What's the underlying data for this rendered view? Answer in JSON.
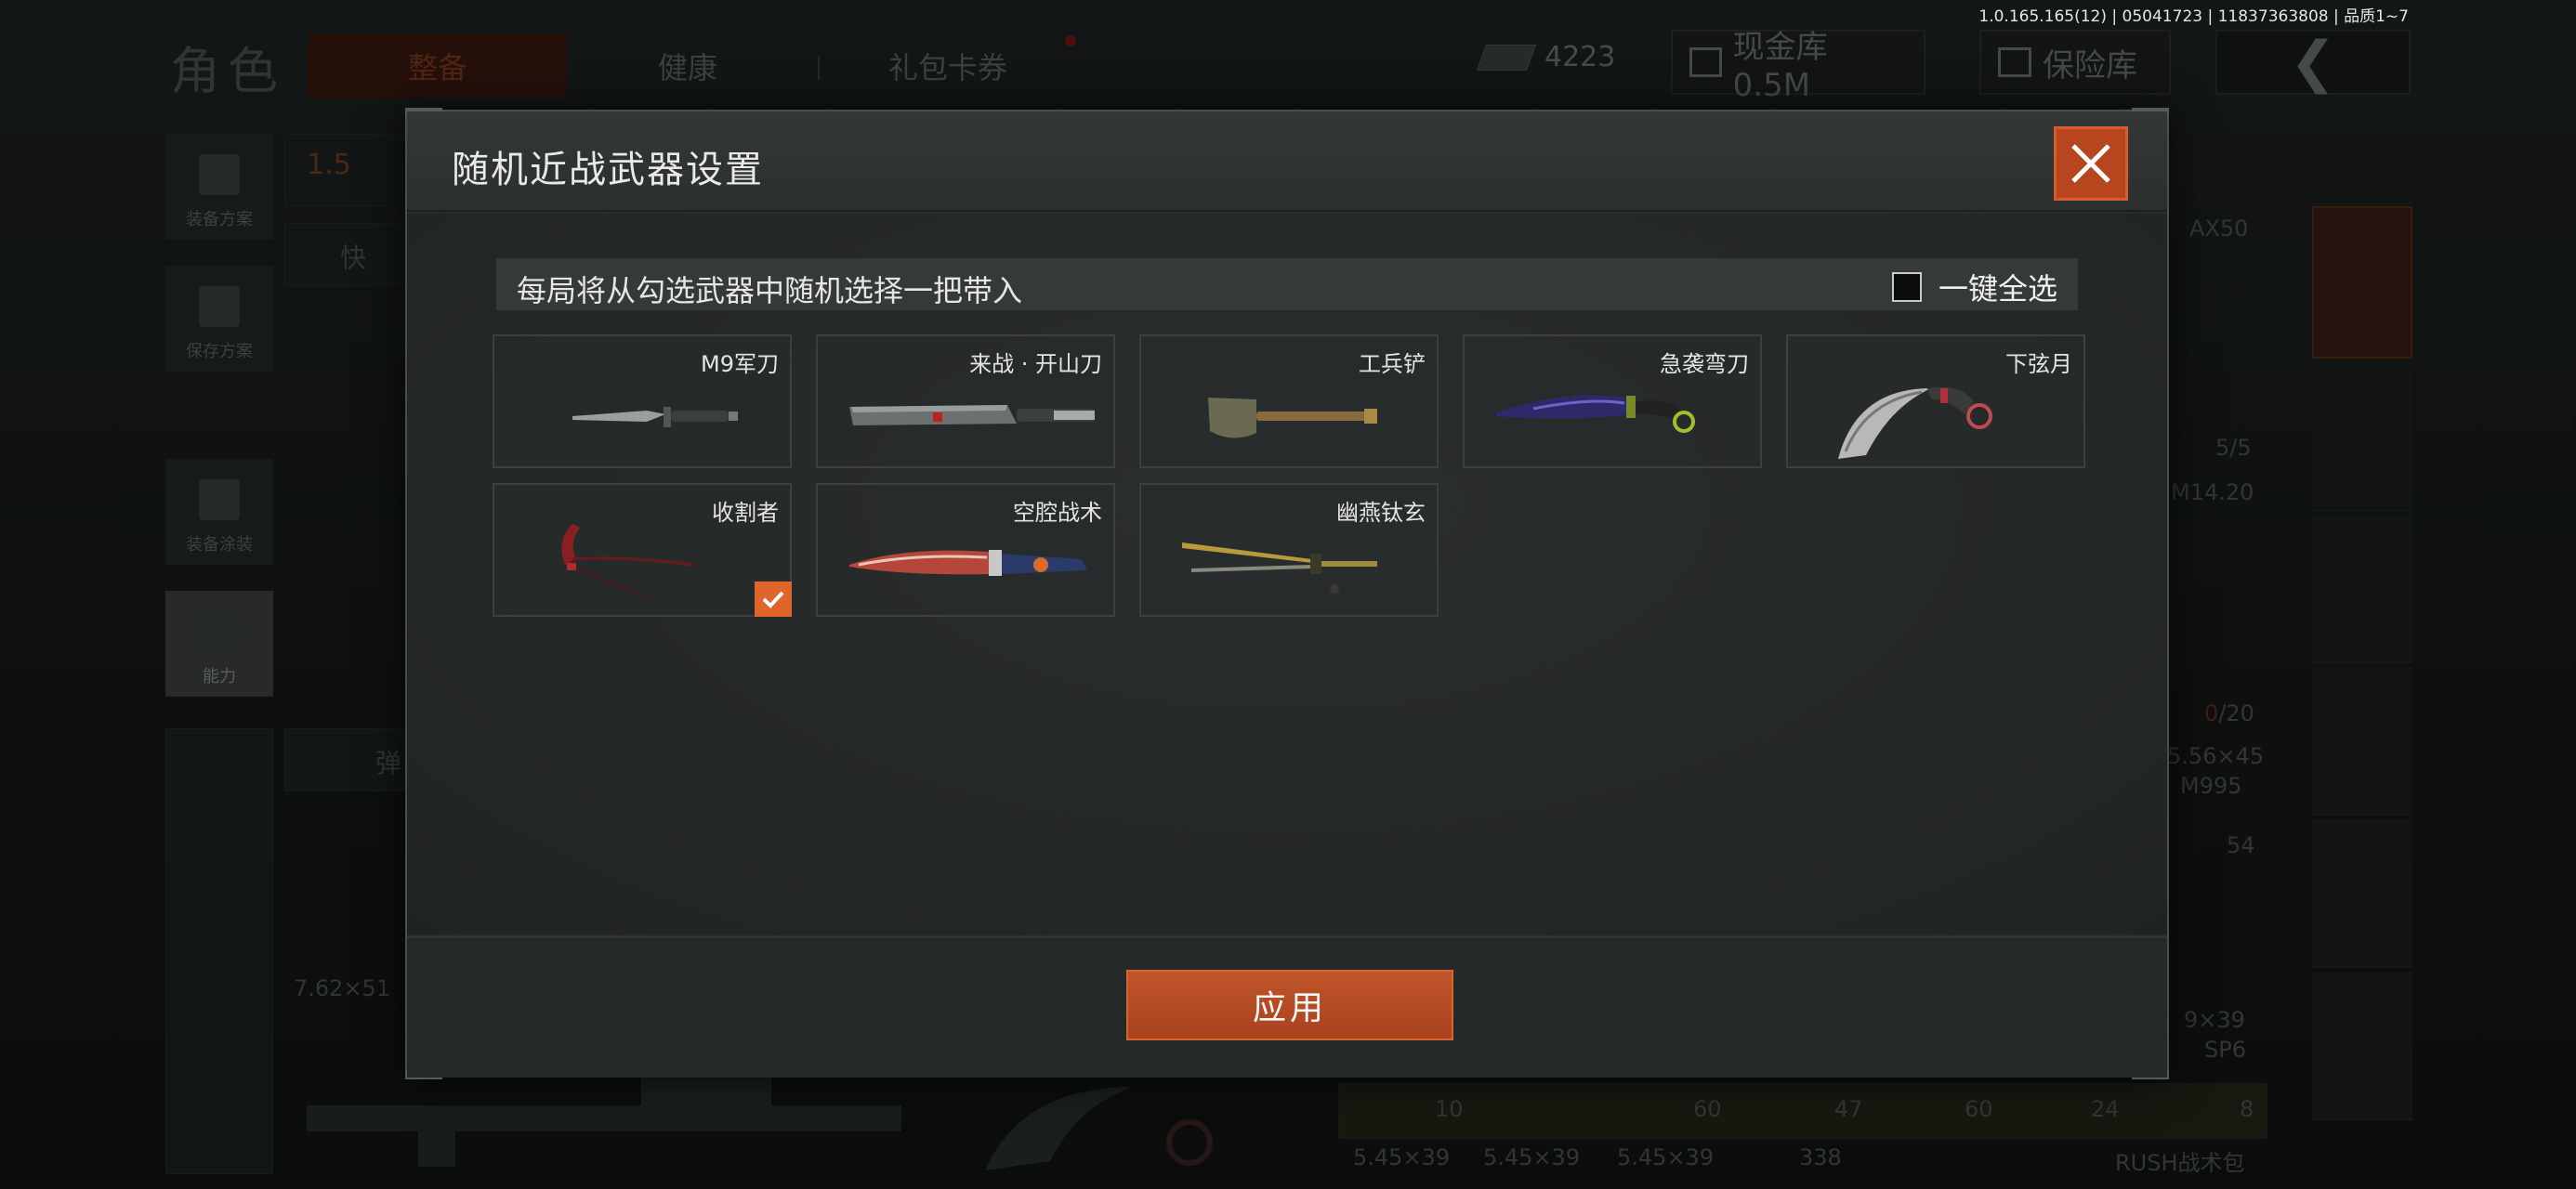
{
  "version_text": "1.0.165.165(12) | 05041723 | 11837363808 | 品质1~7",
  "background": {
    "page_title": "角色",
    "tabs": [
      "整备",
      "健康",
      "礼包卡券"
    ],
    "currency_amount": "4223",
    "cash_vault_label": "现金库 0.5M",
    "safe_vault_label": "保险库",
    "side_buttons": [
      "装备方案",
      "保存方案",
      "装备涂装",
      "能力"
    ],
    "weight_partial": "1.5",
    "quick_label_partial": "快",
    "ammo_label_partial": "弹",
    "caliber_762": "7.62×51",
    "right_labels": {
      "ax50": "AX50",
      "capacity_1": "5/5",
      "m14": "M14.20",
      "capacity_2_red": "0",
      "capacity_2_rest": "/20",
      "caliber_556": "5.56×45",
      "m995": "M995",
      "count_54": "54",
      "caliber_939": "9×39",
      "sp6": "SP6"
    },
    "bottom_counts": [
      "10",
      "60",
      "47",
      "60",
      "24",
      "8"
    ],
    "bottom_calibers": [
      "5.45×39",
      "5.45×39",
      "5.45×39",
      "338",
      "RUSH战术包"
    ]
  },
  "dialog": {
    "title": "随机近战武器设置",
    "instruction": "每局将从勾选武器中随机选择一把带入",
    "select_all_label": "一键全选",
    "select_all_checked": false,
    "apply_label": "应用",
    "accent_color": "#e0652a",
    "weapons": [
      {
        "name": "M9军刀",
        "icon": "bayonet-knife-icon",
        "checked": false
      },
      {
        "name": "来战 · 开山刀",
        "icon": "machete-icon",
        "checked": false
      },
      {
        "name": "工兵铲",
        "icon": "shovel-icon",
        "checked": false
      },
      {
        "name": "急袭弯刀",
        "icon": "curved-knife-icon",
        "checked": false
      },
      {
        "name": "下弦月",
        "icon": "karambit-icon",
        "checked": false
      },
      {
        "name": "收割者",
        "icon": "scythe-icon",
        "checked": true
      },
      {
        "name": "空腔战术",
        "icon": "tactical-blade-icon",
        "checked": false
      },
      {
        "name": "幽燕钛玄",
        "icon": "twin-blade-icon",
        "checked": false
      }
    ]
  }
}
